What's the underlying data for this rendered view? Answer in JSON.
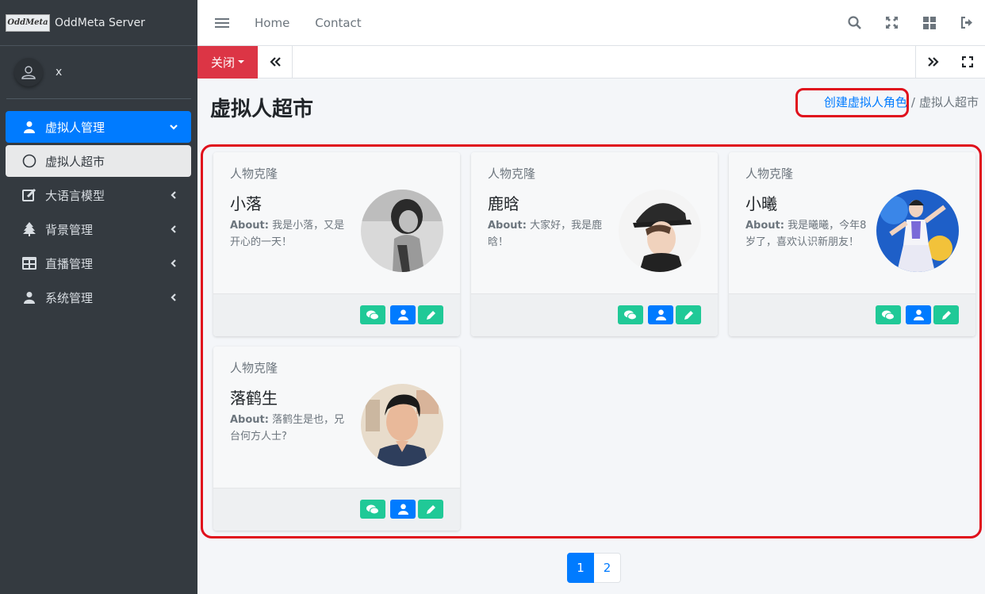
{
  "brand": {
    "logo_text": "OddMeta",
    "name": "OddMeta Server"
  },
  "user": {
    "name": "x"
  },
  "sidebar": {
    "items": [
      {
        "label": "虚拟人管理",
        "icon": "user-icon"
      },
      {
        "label": "虚拟人超市",
        "icon": "circle-icon"
      },
      {
        "label": "大语言模型",
        "icon": "edit-icon"
      },
      {
        "label": "背景管理",
        "icon": "tree-icon"
      },
      {
        "label": "直播管理",
        "icon": "table-icon"
      },
      {
        "label": "系统管理",
        "icon": "user-icon"
      }
    ]
  },
  "topbar": {
    "home": "Home",
    "contact": "Contact"
  },
  "tabbar": {
    "close_label": "关闭"
  },
  "header": {
    "title": "虚拟人超市",
    "breadcrumb_link": "创建虚拟人角色",
    "breadcrumb_sep": "/",
    "breadcrumb_current": "虚拟人超市"
  },
  "cards": [
    {
      "header": "人物克隆",
      "name": "小落",
      "about_label": "About:",
      "about": "我是小落，又是开心的一天！"
    },
    {
      "header": "人物克隆",
      "name": "鹿晗",
      "about_label": "About:",
      "about": "大家好，我是鹿晗！"
    },
    {
      "header": "人物克隆",
      "name": "小曦",
      "about_label": "About:",
      "about": "我是曦曦，今年8岁了，喜欢认识新朋友！"
    },
    {
      "header": "人物克隆",
      "name": "落鹤生",
      "about_label": "About:",
      "about": "落鹤生是也，兄台何方人士?"
    }
  ],
  "pagination": {
    "pages": [
      "1",
      "2"
    ],
    "current": "1"
  },
  "colors": {
    "sidebar": "#343a40",
    "primary": "#007bff",
    "danger": "#dc3545",
    "teal": "#20c997",
    "highlight": "#e0101c"
  }
}
